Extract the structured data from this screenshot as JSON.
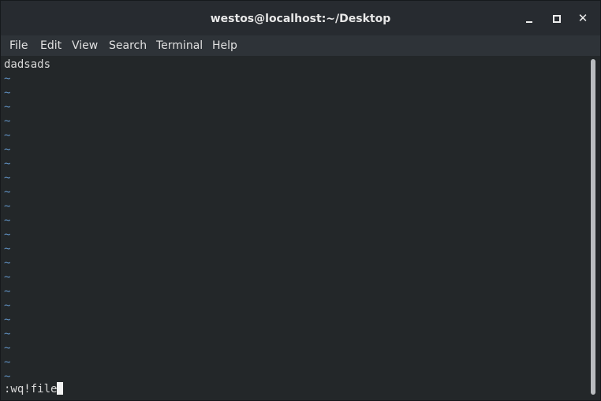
{
  "window": {
    "title": "westos@localhost:~/Desktop",
    "controls": {
      "minimize_icon": "window-minimize-icon",
      "maximize_icon": "window-maximize-icon",
      "close_icon": "window-close-icon",
      "close_glyph": "✕"
    }
  },
  "menu": {
    "items": [
      {
        "label": "File"
      },
      {
        "label": "Edit"
      },
      {
        "label": "View"
      },
      {
        "label": "Search"
      },
      {
        "label": "Terminal"
      },
      {
        "label": "Help"
      }
    ]
  },
  "editor": {
    "first_line": "dadsads",
    "tilde": "~",
    "tilde_count": 22,
    "command_line": ":wq!file"
  },
  "colors": {
    "terminal_bg": "#232729",
    "tilde": "#5f8fbf",
    "text": "#d8d8d8"
  }
}
